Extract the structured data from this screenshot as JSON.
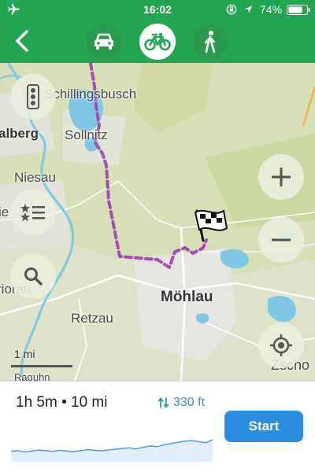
{
  "status_bar": {
    "time": "16:02",
    "battery_percent": "74%",
    "icons": [
      "airplane-icon",
      "orientation-lock-icon",
      "location-arrow-icon",
      "battery-icon"
    ]
  },
  "nav": {
    "back_icon": "chevron-left-icon",
    "modes": [
      {
        "name": "car",
        "icon": "car-icon",
        "active": false
      },
      {
        "name": "bike",
        "icon": "bicycle-icon",
        "active": true
      },
      {
        "name": "walk",
        "icon": "pedestrian-icon",
        "active": false
      }
    ]
  },
  "map": {
    "labels": {
      "schillingsbusch": "Schillingsbusch",
      "sollnitz": "Sollnitz",
      "alberg": "alberg",
      "niesau": "Niesau",
      "ie": "ie",
      "riorau": "riorau",
      "mohlau": "Möhlau",
      "retzau": "Retzau",
      "zscho": "Zscho",
      "raguhn": "Raguhn"
    },
    "scale_label": "1 mi",
    "controls": [
      "traffic-light-icon",
      "bookmarks-list-icon",
      "search-icon",
      "zoom-in-icon",
      "zoom-out-icon",
      "my-location-icon"
    ],
    "colors": {
      "route": "#a04fb5",
      "water": "#7ec8e3",
      "forest": "#c7d6a0",
      "finish_flag": "#111111"
    }
  },
  "panel": {
    "summary": "1h 5m • 10 mi",
    "elevation_gain": "330 ft",
    "start_label": "Start",
    "elevation_profile": [
      0.2,
      0.22,
      0.18,
      0.21,
      0.24,
      0.22,
      0.2,
      0.23,
      0.21,
      0.19,
      0.22,
      0.25,
      0.23,
      0.21,
      0.24,
      0.26,
      0.28,
      0.3,
      0.27,
      0.31,
      0.35,
      0.33,
      0.38,
      0.42,
      0.45,
      0.48,
      0.5,
      0.47,
      0.44,
      0.52
    ]
  },
  "colors": {
    "brand_green": "#22a651",
    "start_button": "#2b8fe1",
    "elevation_line": "#4a9ee6"
  }
}
